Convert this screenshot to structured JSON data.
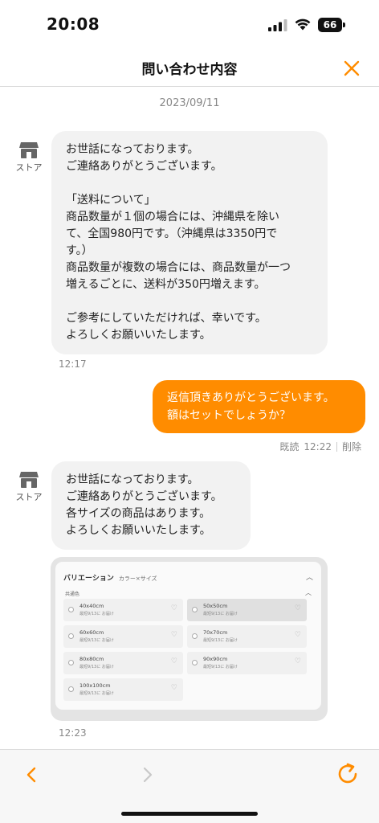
{
  "status_bar": {
    "time": "20:08",
    "battery": "66"
  },
  "header": {
    "title": "問い合わせ内容"
  },
  "colors": {
    "accent": "#ff8c00",
    "bubble_gray": "#f2f2f2"
  },
  "conversation": {
    "date": "2023/09/11",
    "messages": [
      {
        "sender": "store",
        "sender_label": "ストア",
        "text": "お世話になっております。\nご連絡ありがとうございます。\n\n「送料について」\n商品数量が１個の場合には、沖縄県を除い\nて、全国980円です。（沖縄県は3350円で\nす。）\n商品数量が複数の場合には、商品数量が一つ\n増えるごとに、送料が350円増えます。\n\nご参考にしていただければ、幸いです。\nよろしくお願いいたします。",
        "time": "12:17"
      },
      {
        "sender": "user",
        "text": "返信頂きありがとうございます。\n額はセットでしょうか？",
        "read_label": "既読",
        "time": "12:22",
        "delete_label": "削除"
      },
      {
        "sender": "store",
        "sender_label": "ストア",
        "text": "お世話になっております。\nご連絡ありがとうございます。\n各サイズの商品はあります。\nよろしくお願いいたします。",
        "time": "12:23"
      }
    ],
    "attachment": {
      "title": "バリエーション",
      "subtitle": "カラー×サイズ",
      "group_label": "共通色",
      "options": [
        {
          "name": "40x40cm",
          "note": "最短9/13に お届け"
        },
        {
          "name": "50x50cm",
          "note": "最短9/13に お届け"
        },
        {
          "name": "60x60cm",
          "note": "最短9/13に お届け"
        },
        {
          "name": "70x70cm",
          "note": "最短9/13に お届け"
        },
        {
          "name": "80x80cm",
          "note": "最短9/13に お届け"
        },
        {
          "name": "90x90cm",
          "note": "最短9/13に お届け"
        },
        {
          "name": "100x100cm",
          "note": "最短9/13に お届け"
        }
      ]
    }
  },
  "toolbar": {
    "back_icon": "chevron-left-icon",
    "forward_icon": "chevron-right-icon",
    "reload_icon": "reload-icon"
  }
}
